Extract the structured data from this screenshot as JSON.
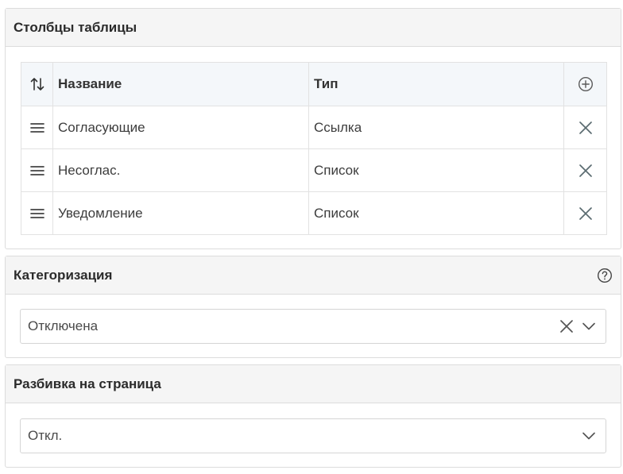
{
  "columns_panel": {
    "title": "Столбцы таблицы",
    "headers": {
      "name": "Название",
      "type": "Тип"
    },
    "rows": [
      {
        "name": "Согласующие",
        "type": "Ссылка"
      },
      {
        "name": "Несоглас.",
        "type": "Список"
      },
      {
        "name": "Уведомление",
        "type": "Список"
      }
    ],
    "icons": {
      "sort": "sort-arrows-icon",
      "add": "plus-circle-icon",
      "drag": "drag-handle-icon",
      "remove": "close-icon"
    }
  },
  "categorization_panel": {
    "title": "Категоризация",
    "value": "Отключена",
    "icons": {
      "help": "question-circle-icon",
      "clear": "close-icon",
      "dropdown": "chevron-down-icon"
    }
  },
  "paging_panel": {
    "title": "Разбивка на страница",
    "value": "Откл.",
    "icons": {
      "dropdown": "chevron-down-icon"
    }
  },
  "colors": {
    "icon": "#5a5a5a",
    "border": "#dcdcdc",
    "header_bg": "#f5f5f5"
  }
}
